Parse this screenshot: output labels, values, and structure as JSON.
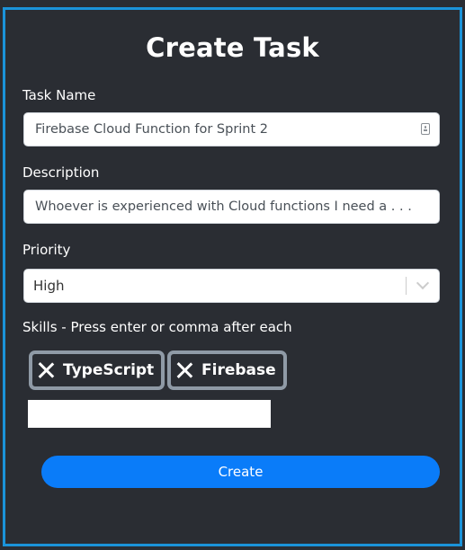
{
  "form": {
    "title": "Create Task",
    "task_name": {
      "label": "Task Name",
      "value": "Firebase Cloud Function for Sprint 2"
    },
    "description": {
      "label": "Description",
      "value": "Whoever is experienced with Cloud functions I need a . . ."
    },
    "priority": {
      "label": "Priority",
      "selected": "High"
    },
    "skills": {
      "label": "Skills - Press enter or comma after each",
      "tags": [
        "TypeScript",
        "Firebase"
      ],
      "input_value": ""
    },
    "submit_label": "Create"
  },
  "colors": {
    "background": "#2a2d33",
    "frame_border": "#1b93d9",
    "button": "#0a7cf9",
    "chip_border": "#8f9aa6"
  },
  "icons": {
    "task_name_field": "contact-card-icon",
    "priority_select": "chevron-down-icon",
    "tag_remove": "close-icon"
  }
}
